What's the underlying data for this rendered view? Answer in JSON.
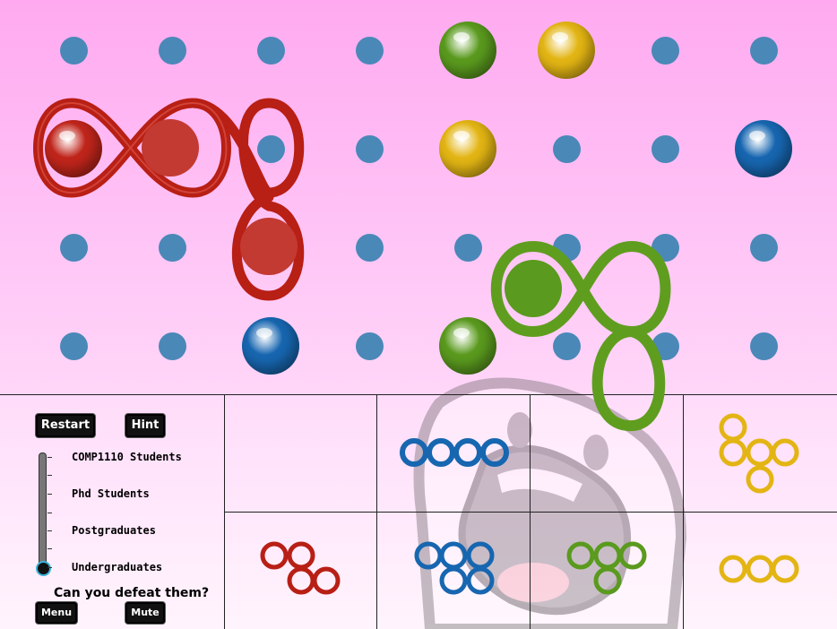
{
  "controls": {
    "restart_label": "Restart",
    "hint_label": "Hint",
    "menu_label": "Menu",
    "mute_label": "Mute",
    "challenge_text": "Can you defeat them?"
  },
  "difficulty": {
    "levels": [
      "COMP1110 Students",
      "Phd Students",
      "Postgraduates",
      "Undergraduates"
    ],
    "selected": "Undergraduates"
  },
  "board": {
    "rows": 4,
    "cols": 8,
    "peg_color": "#4a88b8",
    "balls": [
      {
        "row": 0,
        "col": 4,
        "color": "green"
      },
      {
        "row": 0,
        "col": 5,
        "color": "yellow"
      },
      {
        "row": 1,
        "col": 0,
        "color": "red"
      },
      {
        "row": 1,
        "col": 4,
        "color": "yellow"
      },
      {
        "row": 1,
        "col": 7,
        "color": "blue"
      },
      {
        "row": 3,
        "col": 2,
        "color": "blue"
      },
      {
        "row": 3,
        "col": 4,
        "color": "green"
      }
    ],
    "placed_pieces": [
      {
        "color": "red",
        "shape": "three-loop-with-tail"
      },
      {
        "color": "green",
        "shape": "two-loop-bent"
      }
    ]
  },
  "tray": {
    "pieces": [
      {
        "color": "blue",
        "shape": "four-loop-line"
      },
      {
        "color": "yellow",
        "shape": "tee"
      },
      {
        "color": "red",
        "shape": "three-loop-with-tail"
      },
      {
        "color": "blue",
        "shape": "four-loop-square"
      },
      {
        "color": "green",
        "shape": "three-loop-with-tail"
      },
      {
        "color": "yellow",
        "shape": "three-loop-line"
      }
    ]
  },
  "colors": {
    "red": "#c0251b",
    "green": "#5a9a1e",
    "yellow": "#e3b514",
    "blue": "#1766b0",
    "background_pink": "#ffc4f6"
  }
}
